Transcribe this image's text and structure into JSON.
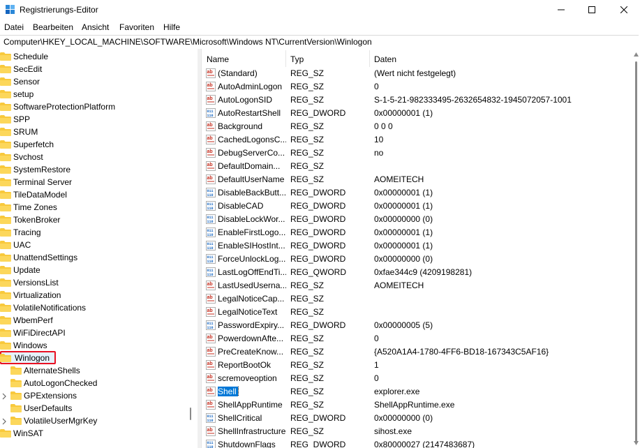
{
  "window": {
    "title": "Registrierungs-Editor"
  },
  "menu": [
    "Datei",
    "Bearbeiten",
    "Ansicht",
    "Favoriten",
    "Hilfe"
  ],
  "address": "Computer\\HKEY_LOCAL_MACHINE\\SOFTWARE\\Microsoft\\Windows NT\\CurrentVersion\\Winlogon",
  "tree": {
    "top_items": [
      "Schedule",
      "SecEdit",
      "Sensor",
      "setup",
      "SoftwareProtectionPlatform",
      "SPP",
      "SRUM",
      "Superfetch",
      "Svchost",
      "SystemRestore",
      "Terminal Server",
      "TileDataModel",
      "Time Zones",
      "TokenBroker",
      "Tracing",
      "UAC",
      "UnattendSettings",
      "Update",
      "VersionsList",
      "Virtualization",
      "VolatileNotifications",
      "WbemPerf",
      "WiFiDirectAPI",
      "Windows"
    ],
    "selected": "Winlogon",
    "children": [
      "AlternateShells",
      "AutoLogonChecked",
      "GPExtensions",
      "UserDefaults",
      "VolatileUserMgrKey"
    ],
    "after": [
      "WinSAT"
    ]
  },
  "columns": {
    "name": "Name",
    "type": "Typ",
    "data": "Daten"
  },
  "values": [
    {
      "name": "(Standard)",
      "type": "REG_SZ",
      "data": "(Wert nicht festgelegt)"
    },
    {
      "name": "AutoAdminLogon",
      "type": "REG_SZ",
      "data": "0"
    },
    {
      "name": "AutoLogonSID",
      "type": "REG_SZ",
      "data": "S-1-5-21-982333495-2632654832-1945072057-1001"
    },
    {
      "name": "AutoRestartShell",
      "type": "REG_DWORD",
      "data": "0x00000001 (1)"
    },
    {
      "name": "Background",
      "type": "REG_SZ",
      "data": "0 0 0"
    },
    {
      "name": "CachedLogonsC...",
      "type": "REG_SZ",
      "data": "10"
    },
    {
      "name": "DebugServerCo...",
      "type": "REG_SZ",
      "data": "no"
    },
    {
      "name": "DefaultDomain...",
      "type": "REG_SZ",
      "data": ""
    },
    {
      "name": "DefaultUserName",
      "type": "REG_SZ",
      "data": "AOMEITECH"
    },
    {
      "name": "DisableBackButt...",
      "type": "REG_DWORD",
      "data": "0x00000001 (1)"
    },
    {
      "name": "DisableCAD",
      "type": "REG_DWORD",
      "data": "0x00000001 (1)"
    },
    {
      "name": "DisableLockWor...",
      "type": "REG_DWORD",
      "data": "0x00000000 (0)"
    },
    {
      "name": "EnableFirstLogo...",
      "type": "REG_DWORD",
      "data": "0x00000001 (1)"
    },
    {
      "name": "EnableSIHostInt...",
      "type": "REG_DWORD",
      "data": "0x00000001 (1)"
    },
    {
      "name": "ForceUnlockLog...",
      "type": "REG_DWORD",
      "data": "0x00000000 (0)"
    },
    {
      "name": "LastLogOffEndTi...",
      "type": "REG_QWORD",
      "data": "0xfae344c9 (4209198281)"
    },
    {
      "name": "LastUsedUserna...",
      "type": "REG_SZ",
      "data": "AOMEITECH"
    },
    {
      "name": "LegalNoticeCap...",
      "type": "REG_SZ",
      "data": ""
    },
    {
      "name": "LegalNoticeText",
      "type": "REG_SZ",
      "data": ""
    },
    {
      "name": "PasswordExpiry...",
      "type": "REG_DWORD",
      "data": "0x00000005 (5)"
    },
    {
      "name": "PowerdownAfte...",
      "type": "REG_SZ",
      "data": "0"
    },
    {
      "name": "PreCreateKnow...",
      "type": "REG_SZ",
      "data": "{A520A1A4-1780-4FF6-BD18-167343C5AF16}"
    },
    {
      "name": "ReportBootOk",
      "type": "REG_SZ",
      "data": "1"
    },
    {
      "name": "scremoveoption",
      "type": "REG_SZ",
      "data": "0"
    },
    {
      "name": "Shell",
      "type": "REG_SZ",
      "data": "explorer.exe"
    },
    {
      "name": "ShellAppRuntime",
      "type": "REG_SZ",
      "data": "ShellAppRuntime.exe"
    },
    {
      "name": "ShellCritical",
      "type": "REG_DWORD",
      "data": "0x00000000 (0)"
    },
    {
      "name": "ShellInfrastructure",
      "type": "REG_SZ",
      "data": "sihost.exe"
    },
    {
      "name": "ShutdownFlags",
      "type": "REG_DWORD",
      "data": "0x80000027 (2147483687)"
    }
  ],
  "selected_value": "Shell",
  "colors": {
    "selection": "#0078d7",
    "highlight_box": "#e81123",
    "folder": "#f8c93c"
  },
  "icons": {
    "string_value": "ab-string-icon",
    "binary_value": "binary-value-icon",
    "folder": "folder-icon"
  }
}
